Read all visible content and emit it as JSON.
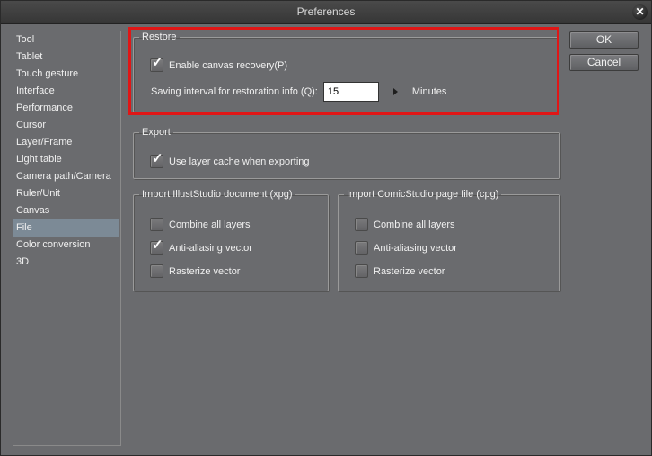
{
  "window": {
    "title": "Preferences",
    "close_icon": "close-icon"
  },
  "sidebar": {
    "items": [
      {
        "label": "Tool"
      },
      {
        "label": "Tablet"
      },
      {
        "label": "Touch gesture"
      },
      {
        "label": "Interface"
      },
      {
        "label": "Performance"
      },
      {
        "label": "Cursor"
      },
      {
        "label": "Layer/Frame"
      },
      {
        "label": "Light table"
      },
      {
        "label": "Camera path/Camera"
      },
      {
        "label": "Ruler/Unit"
      },
      {
        "label": "Canvas"
      },
      {
        "label": "File",
        "selected": true
      },
      {
        "label": "Color conversion"
      },
      {
        "label": "3D"
      }
    ]
  },
  "restore": {
    "legend": "Restore",
    "enable_recovery": {
      "label": "Enable canvas recovery(P)",
      "checked": true
    },
    "interval": {
      "label": "Saving interval for restoration info (Q):",
      "value": "15",
      "unit": "Minutes"
    }
  },
  "export": {
    "legend": "Export",
    "layer_cache": {
      "label": "Use layer cache when exporting",
      "checked": true
    }
  },
  "import_illust": {
    "legend": "Import IllustStudio document (xpg)",
    "options": [
      {
        "label": "Combine all layers",
        "checked": false
      },
      {
        "label": "Anti-aliasing vector",
        "checked": true
      },
      {
        "label": "Rasterize vector",
        "checked": false
      }
    ]
  },
  "import_comic": {
    "legend": "Import ComicStudio page file (cpg)",
    "options": [
      {
        "label": "Combine all layers",
        "checked": false
      },
      {
        "label": "Anti-aliasing vector",
        "checked": false
      },
      {
        "label": "Rasterize vector",
        "checked": false
      }
    ]
  },
  "buttons": {
    "ok": "OK",
    "cancel": "Cancel"
  },
  "colors": {
    "highlight": "#e01616",
    "selected_item": "#7c8a96",
    "background": "#6a6b6e"
  },
  "glyphs": {
    "check": "✓",
    "close": "✕"
  }
}
